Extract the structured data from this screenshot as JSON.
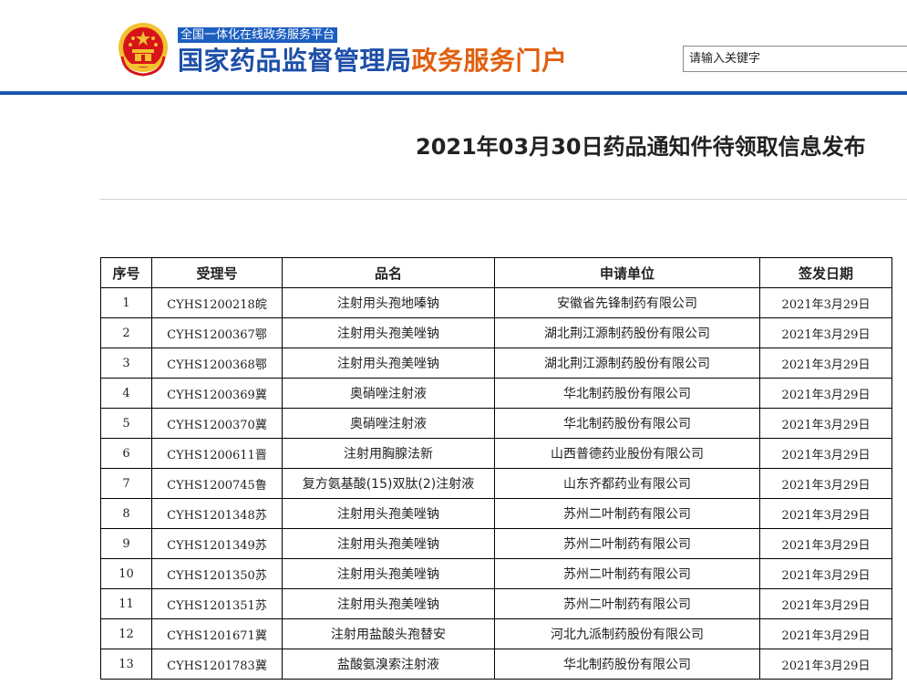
{
  "header": {
    "platform_tag": "全国一体化在线政务服务平台",
    "title_part1": "国家药品监督管理局",
    "title_part2": "政务服务门户",
    "search_placeholder": "请输入关键字",
    "colors": {
      "accent_blue": "#1d4fa8",
      "accent_orange": "#e0600f",
      "emblem_red": "#d7141a",
      "emblem_gold": "#f2c230"
    },
    "emblem_icon": "national-emblem-icon"
  },
  "page": {
    "title": "2021年03月30日药品通知件待领取信息发布"
  },
  "table": {
    "headers": [
      "序号",
      "受理号",
      "品名",
      "申请单位",
      "签发日期"
    ],
    "rows": [
      [
        "1",
        "CYHS1200218皖",
        "注射用头孢地嗪钠",
        "安徽省先锋制药有限公司",
        "2021年3月29日"
      ],
      [
        "2",
        "CYHS1200367鄂",
        "注射用头孢美唑钠",
        "湖北荆江源制药股份有限公司",
        "2021年3月29日"
      ],
      [
        "3",
        "CYHS1200368鄂",
        "注射用头孢美唑钠",
        "湖北荆江源制药股份有限公司",
        "2021年3月29日"
      ],
      [
        "4",
        "CYHS1200369冀",
        "奥硝唑注射液",
        "华北制药股份有限公司",
        "2021年3月29日"
      ],
      [
        "5",
        "CYHS1200370冀",
        "奥硝唑注射液",
        "华北制药股份有限公司",
        "2021年3月29日"
      ],
      [
        "6",
        "CYHS1200611晋",
        "注射用胸腺法新",
        "山西普德药业股份有限公司",
        "2021年3月29日"
      ],
      [
        "7",
        "CYHS1200745鲁",
        "复方氨基酸(15)双肽(2)注射液",
        "山东齐都药业有限公司",
        "2021年3月29日"
      ],
      [
        "8",
        "CYHS1201348苏",
        "注射用头孢美唑钠",
        "苏州二叶制药有限公司",
        "2021年3月29日"
      ],
      [
        "9",
        "CYHS1201349苏",
        "注射用头孢美唑钠",
        "苏州二叶制药有限公司",
        "2021年3月29日"
      ],
      [
        "10",
        "CYHS1201350苏",
        "注射用头孢美唑钠",
        "苏州二叶制药有限公司",
        "2021年3月29日"
      ],
      [
        "11",
        "CYHS1201351苏",
        "注射用头孢美唑钠",
        "苏州二叶制药有限公司",
        "2021年3月29日"
      ],
      [
        "12",
        "CYHS1201671冀",
        "注射用盐酸头孢替安",
        "河北九派制药股份有限公司",
        "2021年3月29日"
      ],
      [
        "13",
        "CYHS1201783冀",
        "盐酸氨溴索注射液",
        "华北制药股份有限公司",
        "2021年3月29日"
      ]
    ]
  }
}
